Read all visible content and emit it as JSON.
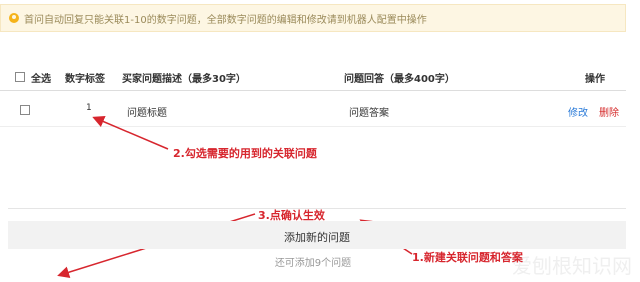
{
  "notice": {
    "text": "首问自动回复只能关联1-10的数字问题，全部数字问题的编辑和修改请到机器人配置中操作"
  },
  "table": {
    "headers": {
      "select_all": "全选",
      "number_tag": "数字标签",
      "description": "买家问题描述（最多30字）",
      "answer": "问题回答（最多400字）",
      "action": "操作"
    },
    "rows": [
      {
        "number": "1",
        "title": "问题标题",
        "answer": "问题答案",
        "edit": "修改",
        "delete": "删除"
      }
    ]
  },
  "annotations": {
    "step2": "2.勾选需要的用到的关联问题",
    "step3": "3.点确认生效",
    "step1": "1.新建关联问题和答案"
  },
  "add_bar": {
    "label": "添加新的问题"
  },
  "remaining": "还可添加9个问题",
  "watermark": "爱刨根知识网",
  "colors": {
    "annotation": "#d7262e",
    "edit_link": "#2a7ad8",
    "delete_link": "#d52a2a",
    "notice_bg": "#fdf6e3"
  }
}
